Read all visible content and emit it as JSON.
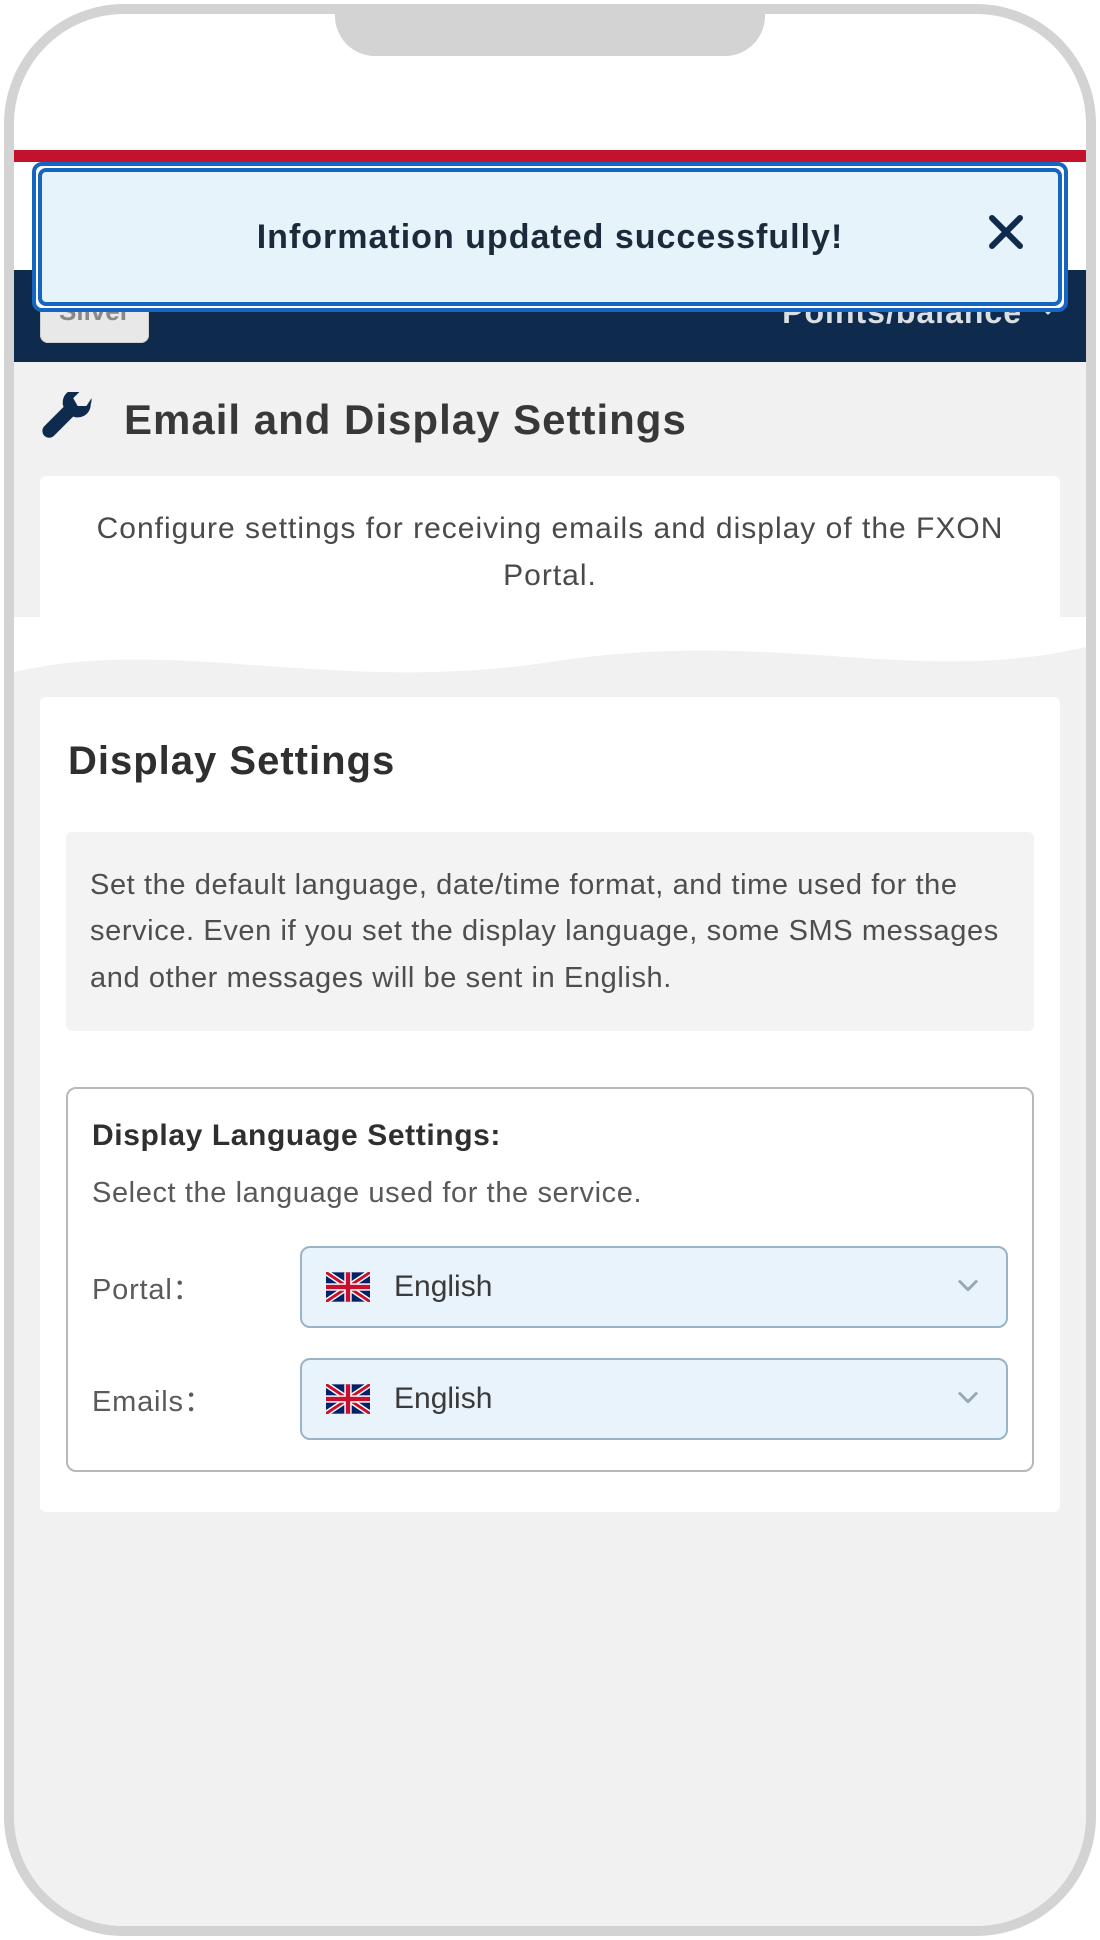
{
  "toast": {
    "message": "Information updated successfully!"
  },
  "header": {
    "tier_chip": "Silver",
    "right_label": "Points/balance"
  },
  "page": {
    "title": "Email and Display Settings",
    "intro": "Configure settings for receiving emails and display of the FXON Portal."
  },
  "section": {
    "title": "Display Settings",
    "description": "Set the default language, date/time format, and time used for the service. Even if you set the display language, some SMS messages and other messages will be sent in English."
  },
  "language_box": {
    "title": "Display Language Settings:",
    "hint": "Select the language used for the service.",
    "rows": {
      "portal": {
        "label": "Portal：",
        "value": "English"
      },
      "emails": {
        "label": "Emails：",
        "value": "English"
      }
    }
  }
}
